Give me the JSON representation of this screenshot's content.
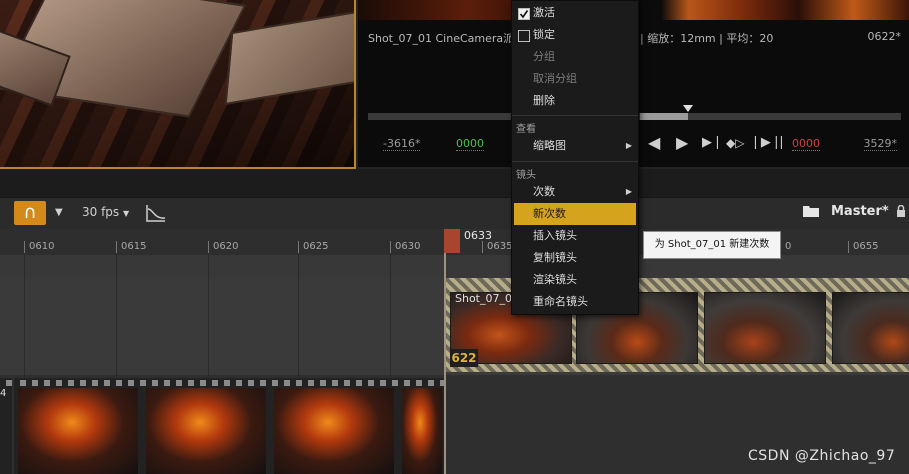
{
  "preview": {
    "info_left": "Shot_07_01  CineCamera派",
    "info_mid": "| 缩放：12mm | 平均：20",
    "info_right": "0622*",
    "time_start": "-3616*",
    "time_green": "0000",
    "time_red": "0000",
    "time_end": "3529*"
  },
  "toolbar": {
    "fps": "30 fps",
    "sequence_name": "Master*"
  },
  "ruler": {
    "ticks": [
      "0610",
      "0615",
      "0620",
      "0625",
      "0630",
      "0635",
      "0655"
    ],
    "partial_tick": "0",
    "playhead_frame": "0633"
  },
  "timeline": {
    "shot_label": "Shot_07_0",
    "shot_frame": "622",
    "film_label": "4"
  },
  "context_menu": {
    "items_top": [
      {
        "label": "激活",
        "checked": true
      },
      {
        "label": "锁定",
        "checked": false
      },
      {
        "label": "分组",
        "disabled": true
      },
      {
        "label": "取消分组",
        "disabled": true
      },
      {
        "label": "删除"
      }
    ],
    "section_view": "查看",
    "view_items": [
      {
        "label": "缩略图"
      }
    ],
    "section_shot": "镜头",
    "shot_items": [
      {
        "label": "次数"
      },
      {
        "label": "新次数",
        "highlighted": true
      },
      {
        "label": "插入镜头"
      },
      {
        "label": "复制镜头"
      },
      {
        "label": "渲染镜头"
      },
      {
        "label": "重命名镜头"
      }
    ]
  },
  "tooltip": "为 Shot_07_01 新建次数",
  "watermark": "CSDN @Zhichao_97",
  "colors": {
    "accent": "#d6a31c",
    "snap_button": "#d48a1b",
    "playhead": "#a8452e"
  },
  "icons": [
    "magnet-icon",
    "curve-editor-icon",
    "folder-icon",
    "lock-icon",
    "play-icon",
    "reverse-play-icon"
  ]
}
